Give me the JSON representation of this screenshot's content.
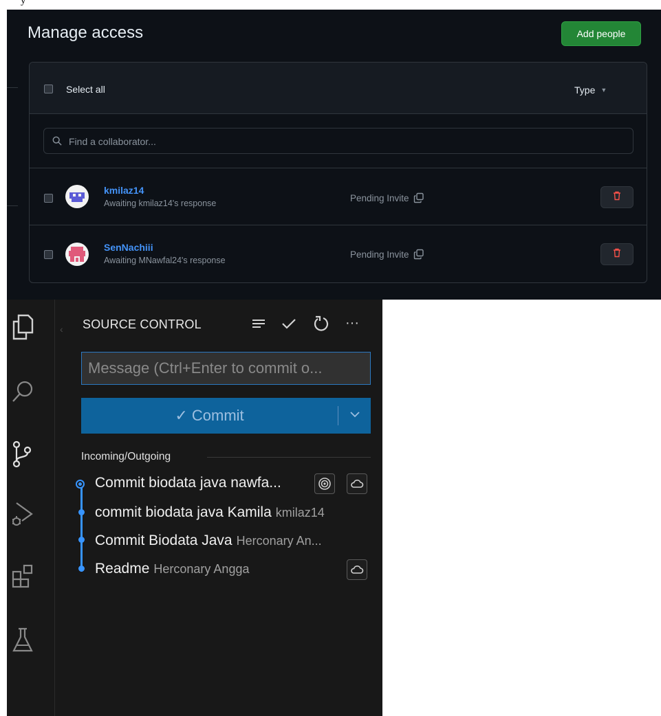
{
  "top_fragment": "y",
  "github": {
    "title": "Manage access",
    "add_button": "Add people",
    "select_all": "Select all",
    "type_filter": "Type",
    "search_placeholder": "Find a collaborator...",
    "collaborators": [
      {
        "username": "kmilaz14",
        "status": "Awaiting kmilaz14's response",
        "invite": "Pending Invite",
        "avatar_color": "#6f6fe0"
      },
      {
        "username": "SenNachiii",
        "status": "Awaiting MNawfal24's response",
        "invite": "Pending Invite",
        "avatar_color": "#e05a7a"
      }
    ],
    "colors": {
      "bg": "#0d1117",
      "accent_green": "#238636",
      "link_blue": "#4493f8",
      "danger": "#f85149"
    }
  },
  "vscode": {
    "panel_title": "SOURCE CONTROL",
    "toolbar": [
      "list-flat-icon",
      "check-icon",
      "refresh-icon",
      "more-icon"
    ],
    "toolbar_more": "···",
    "message_placeholder": "Message (Ctrl+Enter to commit o...",
    "commit_button": "✓ Commit",
    "section_title": "Incoming/Outgoing",
    "commits": [
      {
        "message": "Commit biodata java nawfa...",
        "author": "",
        "badges": [
          "target-icon",
          "cloud-icon"
        ]
      },
      {
        "message": "commit biodata java Kamila",
        "author": "kmilaz14",
        "badges": []
      },
      {
        "message": "Commit Biodata Java",
        "author": "Herconary An...",
        "badges": []
      },
      {
        "message": "Readme",
        "author": "Herconary Angga",
        "badges": [
          "cloud-icon"
        ]
      }
    ],
    "activity_bar": [
      "explorer-icon",
      "search-icon",
      "source-control-icon",
      "run-debug-icon",
      "extensions-icon",
      "testing-icon"
    ],
    "colors": {
      "bg": "#181818",
      "accent_blue": "#0e639c",
      "graph_blue": "#3794ff"
    }
  }
}
